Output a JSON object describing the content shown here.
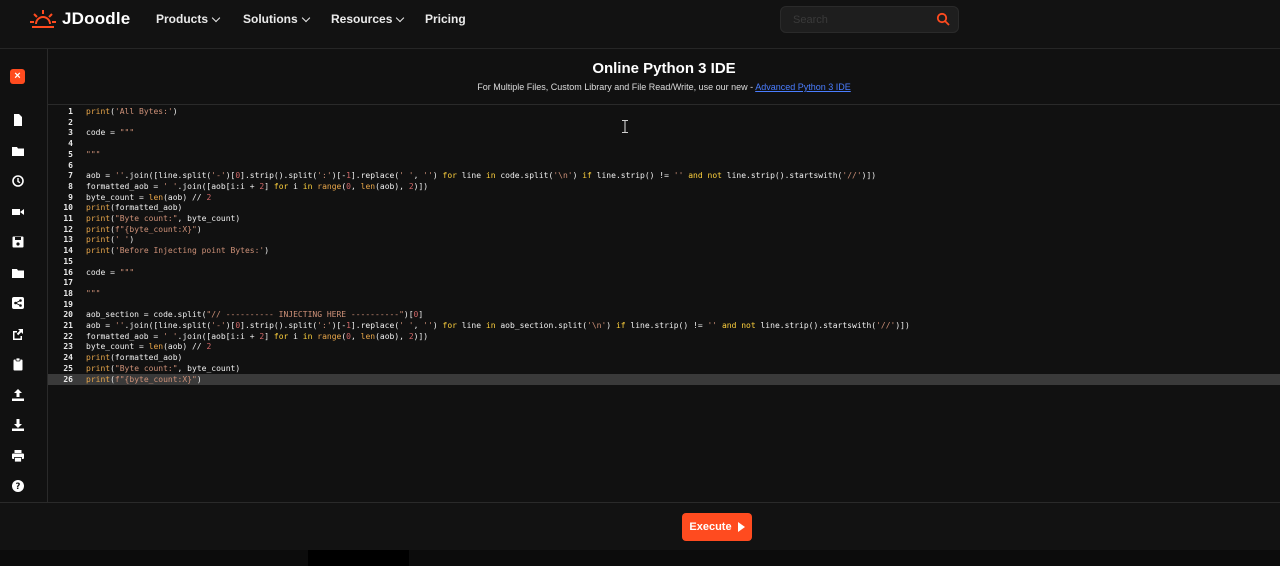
{
  "brand": {
    "name": "JDoodle",
    "accent": "#ff4b1f"
  },
  "nav": {
    "items": [
      {
        "label": "Products",
        "has_dropdown": true
      },
      {
        "label": "Solutions",
        "has_dropdown": true
      },
      {
        "label": "Resources",
        "has_dropdown": true
      },
      {
        "label": "Pricing",
        "has_dropdown": false
      }
    ],
    "search": {
      "placeholder": "Search",
      "icon": "search-icon"
    }
  },
  "sidebar": {
    "close_icon": "close-icon",
    "tools": [
      "new-file-icon",
      "open-folder-icon",
      "history-icon",
      "video-icon",
      "save-icon",
      "folder-icon",
      "share-icon",
      "external-share-icon",
      "clipboard-icon",
      "upload-icon",
      "download-icon",
      "print-icon",
      "help-icon"
    ]
  },
  "header": {
    "title": "Online Python 3 IDE",
    "subtitle_text": "For Multiple Files, Custom Library and File Read/Write, use our new - ",
    "subtitle_link": "Advanced Python 3 IDE"
  },
  "editor": {
    "active_line": 26,
    "lines": [
      "print('All Bytes:')",
      "",
      "code = \"\"\"",
      "",
      "\"\"\"",
      "",
      "aob = ''.join([line.split('-')[0].strip().split(':')[-1].replace(' ', '') for line in code.split('\\n') if line.strip() != '' and not line.strip().startswith('//')])",
      "formatted_aob = ' '.join([aob[i:i + 2] for i in range(0, len(aob), 2)])",
      "byte_count = len(aob) // 2",
      "print(formatted_aob)",
      "print(\"Byte count:\", byte_count)",
      "print(f\"{byte_count:X}\")",
      "print(' ')",
      "print('Before Injecting point Bytes:')",
      "",
      "code = \"\"\"",
      "",
      "\"\"\"",
      "",
      "aob_section = code.split(\"// ---------- INJECTING HERE ----------\")[0]",
      "aob = ''.join([line.split('-')[0].strip().split(':')[-1].replace(' ', '') for line in aob_section.split('\\n') if line.strip() != '' and not line.strip().startswith('//')])",
      "formatted_aob = ' '.join([aob[i:i + 2] for i in range(0, len(aob), 2)])",
      "byte_count = len(aob) // 2",
      "print(formatted_aob)",
      "print(\"Byte count:\", byte_count)",
      "print(f\"{byte_count:X}\")"
    ]
  },
  "footer": {
    "execute_label": "Execute"
  }
}
